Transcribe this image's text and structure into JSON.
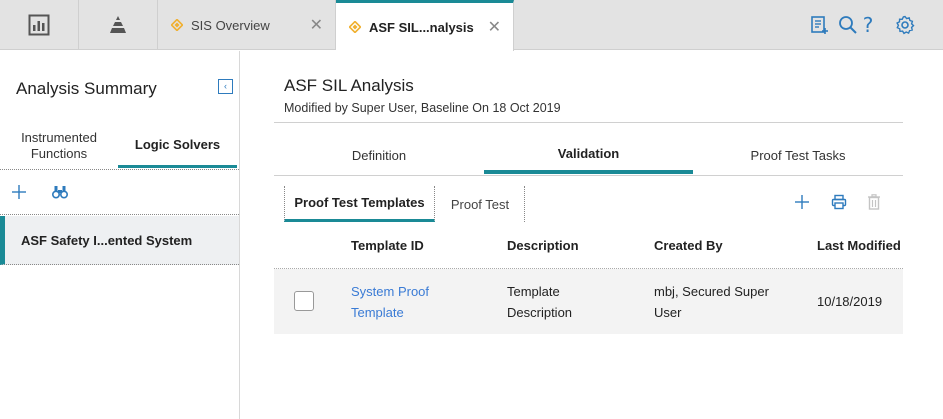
{
  "topbar": {
    "tabs": [
      {
        "label": "SIS Overview"
      },
      {
        "label": "ASF SIL...nalysis"
      }
    ]
  },
  "left_panel": {
    "title": "Analysis Summary",
    "tabs": [
      {
        "label_line1": "Instrumented",
        "label_line2": "Functions"
      },
      {
        "label": "Logic Solvers"
      }
    ],
    "list_items": [
      {
        "label": "ASF Safety I...ented System"
      }
    ]
  },
  "main": {
    "title": "ASF SIL Analysis",
    "subtitle": "Modified by Super User, Baseline On 18 Oct 2019",
    "tabs": [
      {
        "label": "Definition"
      },
      {
        "label": "Validation"
      },
      {
        "label": "Proof Test Tasks"
      }
    ],
    "subtabs": [
      {
        "label": "Proof Test Templates"
      },
      {
        "label": "Proof Test"
      }
    ],
    "grid": {
      "columns": [
        "Template ID",
        "Description",
        "Created By",
        "Last Modified"
      ],
      "rows": [
        {
          "template_id_line1": "System Proof",
          "template_id_line2": "Template",
          "description_line1": "Template",
          "description_line2": "Description",
          "created_by_line1": "mbj, Secured Super",
          "created_by_line2": "User",
          "last_modified": "10/18/2019"
        }
      ]
    }
  },
  "colors": {
    "accent": "#1a8a96",
    "link": "#3a7bd5",
    "icon": "#2e7bbd",
    "diamond": "#f0b030"
  }
}
